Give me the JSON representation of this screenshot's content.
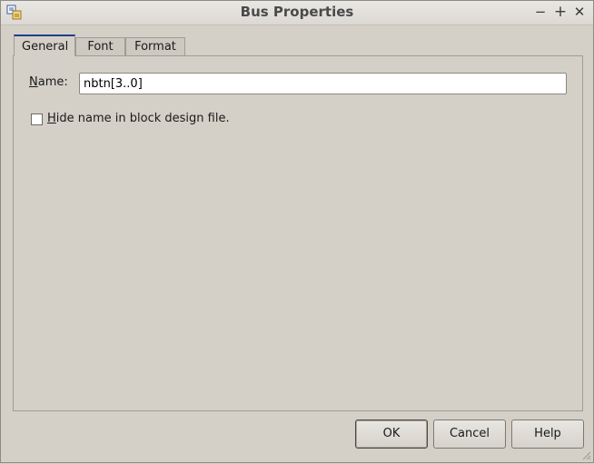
{
  "window": {
    "title": "Bus Properties",
    "controls": {
      "minimize": "−",
      "maximize": "+",
      "close": "✕"
    },
    "app_icon": "bus-properties-icon"
  },
  "tabs": [
    {
      "label": "General",
      "selected": true
    },
    {
      "label": "Font",
      "selected": false
    },
    {
      "label": "Format",
      "selected": false
    }
  ],
  "general": {
    "name_label": "Name:",
    "name_label_mnemonic": "N",
    "name_label_rest": "ame:",
    "name_value": "nbtn[3..0]",
    "hide_checkbox": {
      "checked": false,
      "label": "Hide name in block design file.",
      "mnemonic": "H",
      "label_rest": "ide name in block design file."
    }
  },
  "buttons": {
    "ok": "OK",
    "cancel": "Cancel",
    "help": "Help"
  },
  "colors": {
    "background": "#d4d0c8",
    "selected_tab_accent": "#1f3e8c"
  }
}
